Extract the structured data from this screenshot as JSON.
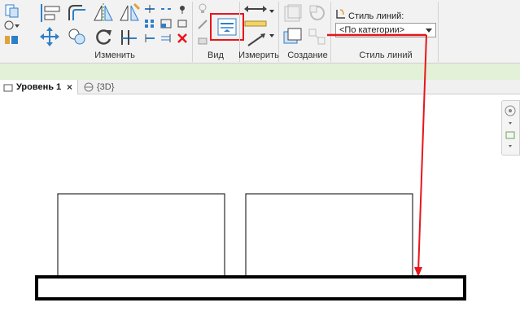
{
  "ribbon": {
    "panels": {
      "modify": "Изменить",
      "view": "Вид",
      "measure": "Измерить",
      "create": "Создание",
      "line_style": "Стиль линий"
    },
    "line_style": {
      "label": "Стиль линий:",
      "value": "<По категории>"
    }
  },
  "tabs": [
    {
      "label": "Уровень 1",
      "active": true
    },
    {
      "label": "{3D}",
      "active": false
    }
  ],
  "colors": {
    "annotation": "#e8151b",
    "ribbon_strip": "#e3f1d8",
    "icon_blue": "#2f7fc8"
  }
}
